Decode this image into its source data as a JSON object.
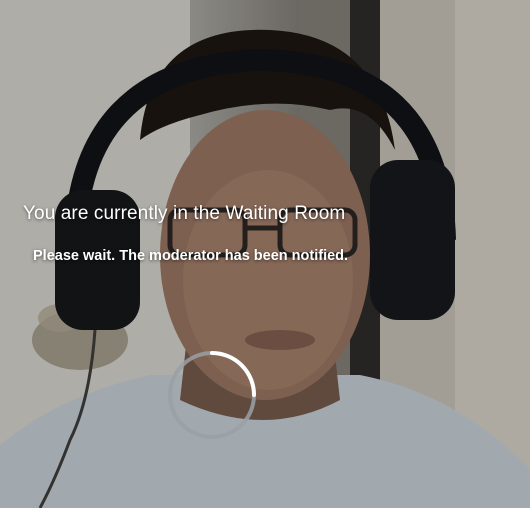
{
  "waiting_room": {
    "title": "You are currently in the Waiting Room",
    "subtitle": "Please wait. The moderator has been notified.",
    "spinner_icon": "loading-spinner-icon"
  },
  "video": {
    "description_icon": "webcam-self-view"
  },
  "colors": {
    "text": "#ffffff",
    "spinner_track": "#9aa0a6",
    "spinner_arc": "#ffffff"
  }
}
